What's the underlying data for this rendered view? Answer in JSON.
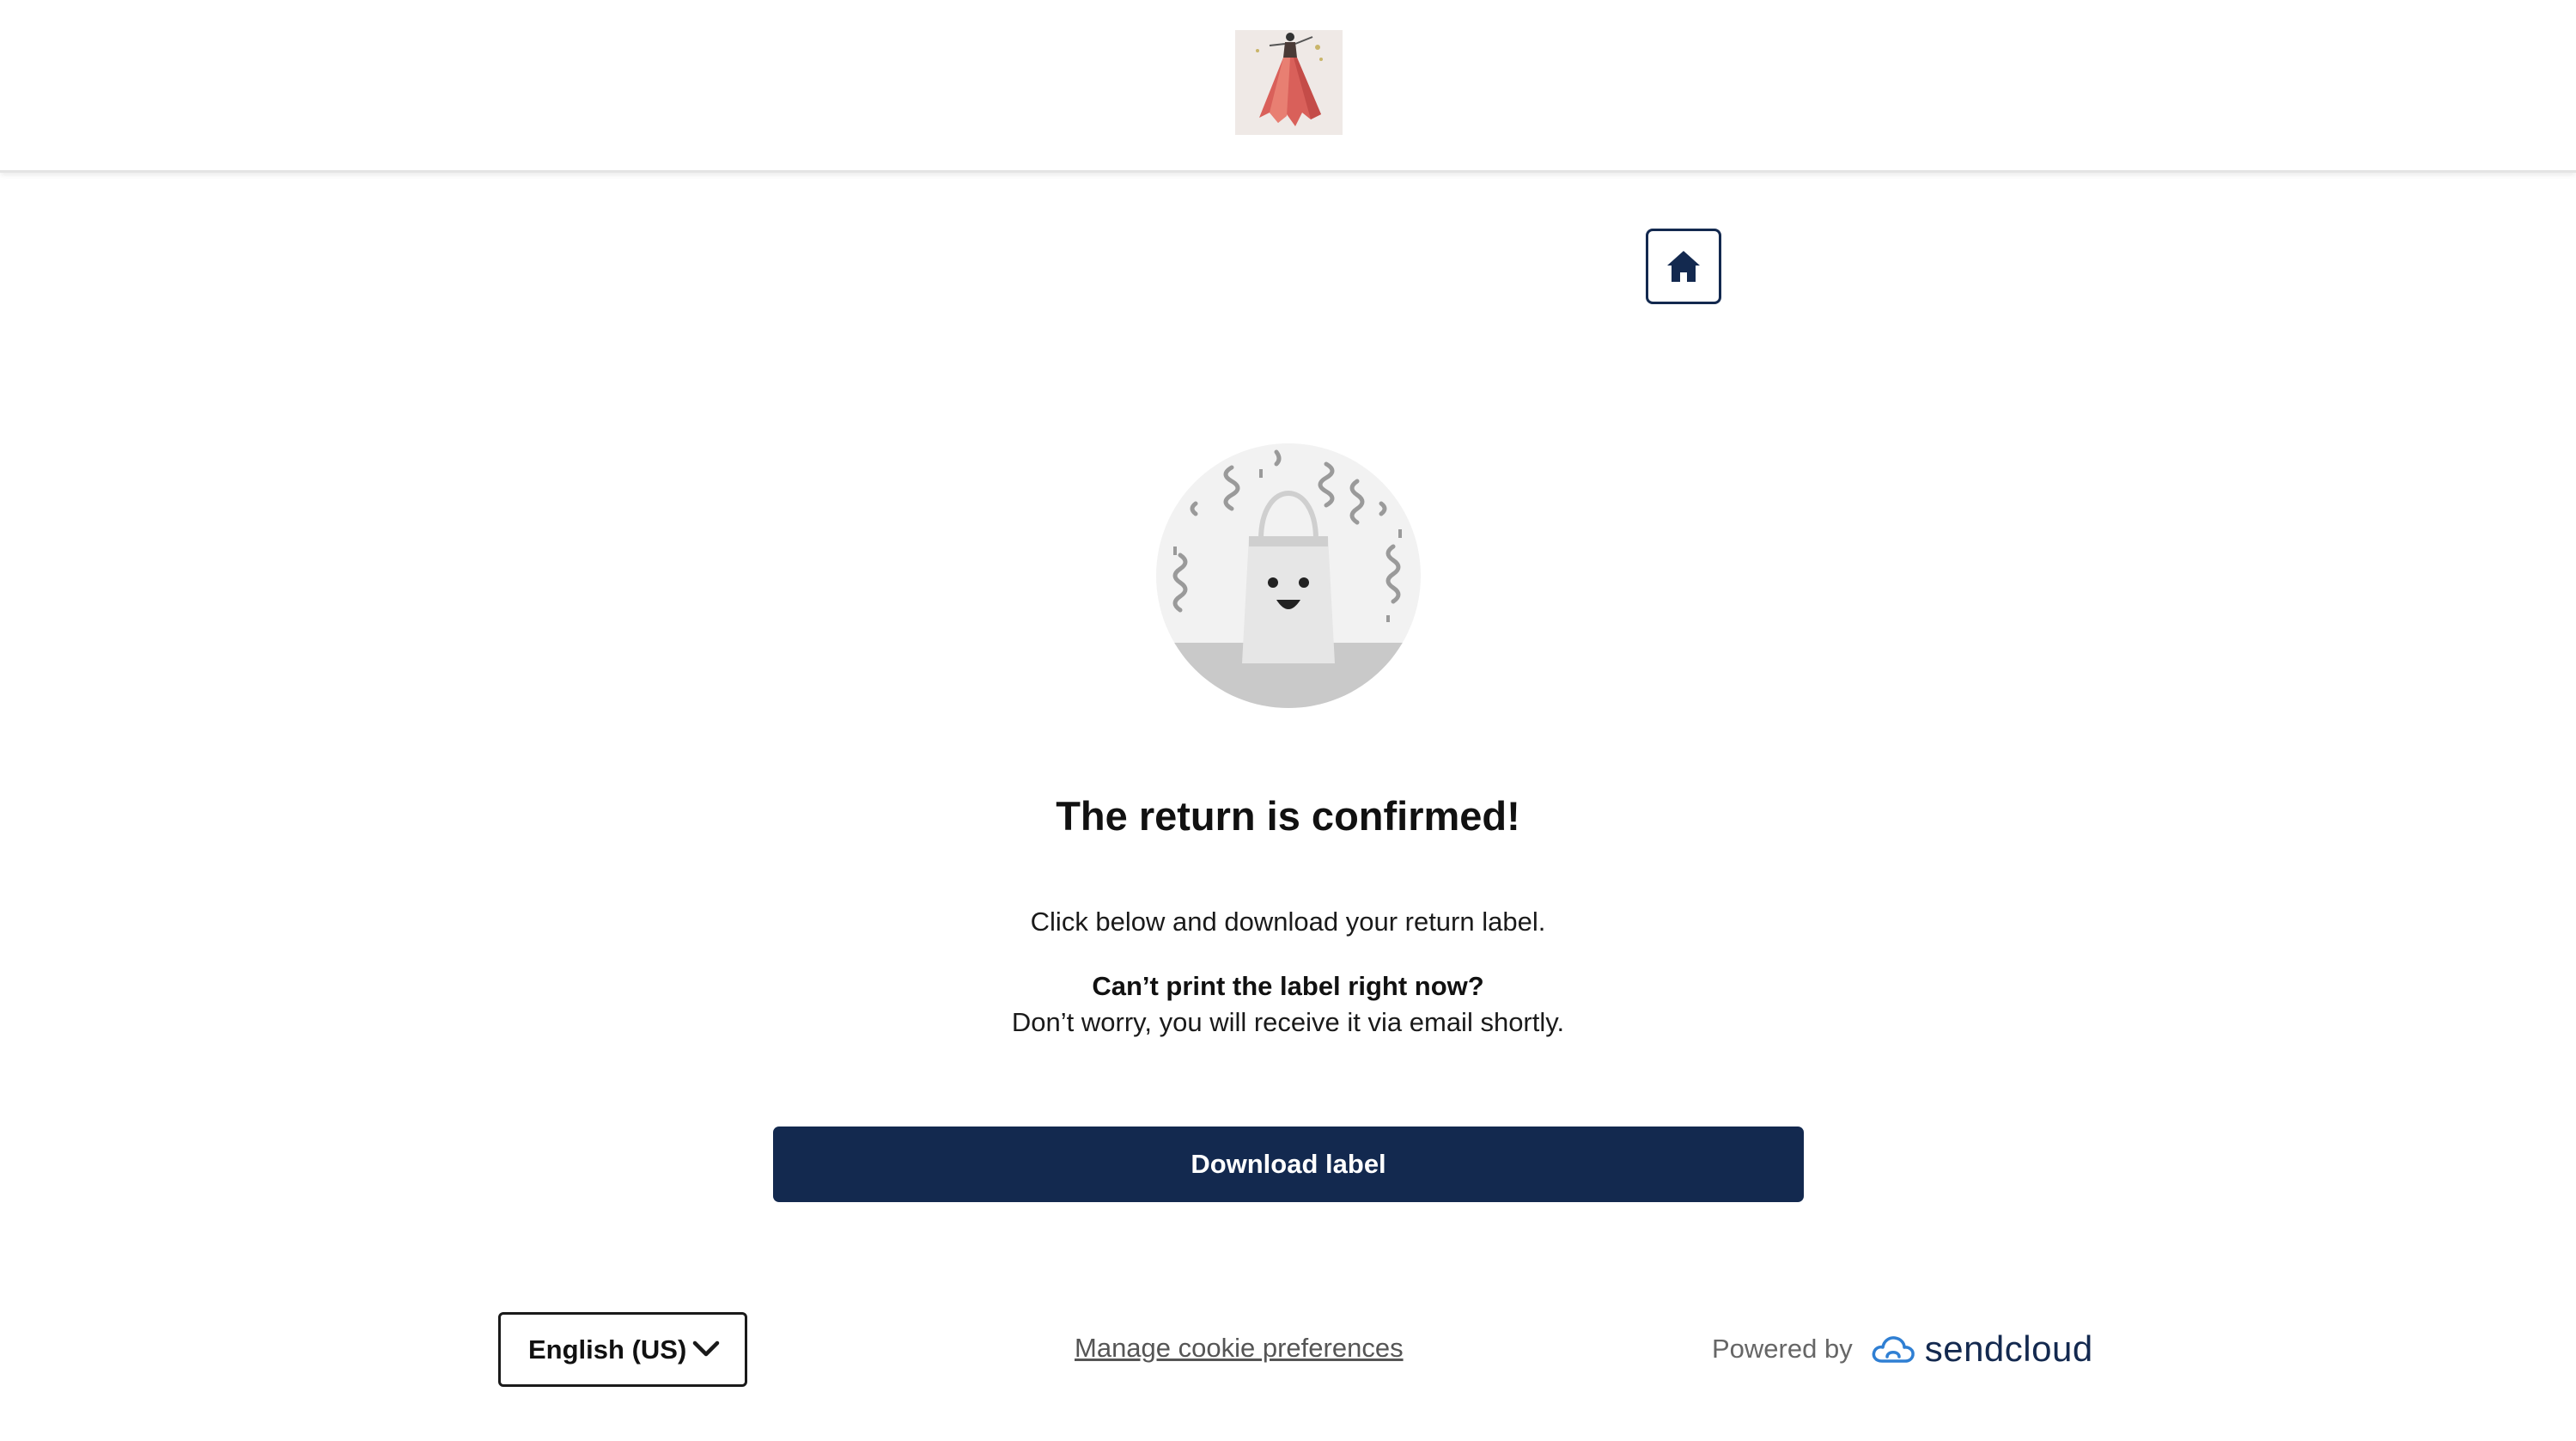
{
  "header": {
    "logo_icon": "store-logo-dress-image"
  },
  "nav": {
    "home_icon": "home-icon",
    "home_color": "#13294f"
  },
  "confirmation": {
    "illustration_icon": "happy-shopping-bag-confetti-illustration",
    "title": "The return is confirmed!",
    "subtitle": "Click below and download your return label.",
    "note_title": "Can’t print the label right now?",
    "note_text": "Don’t worry, you will receive it via email shortly.",
    "download_label": "Download label",
    "accent_color": "#13294f"
  },
  "footer": {
    "language": "English (US)",
    "cookie_link": "Manage cookie preferences",
    "powered_by": "Powered by",
    "brand": "sendcloud",
    "brand_icon": "sendcloud-cloud-icon",
    "brand_color": "#13294f",
    "brand_icon_color": "#2f7fd3"
  }
}
